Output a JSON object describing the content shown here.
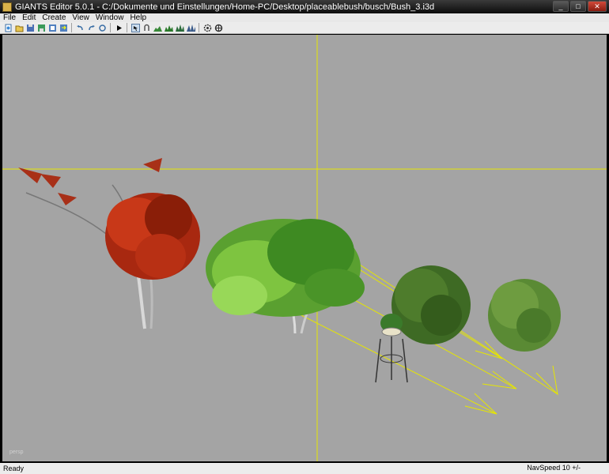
{
  "window": {
    "title": "GIANTS Editor 5.0.1 - C:/Dokumente und Einstellungen/Home-PC/Desktop/placeablebush/busch/Bush_3.i3d",
    "minimize": "_",
    "maximize": "□",
    "close": "✕"
  },
  "menu": {
    "file": "File",
    "edit": "Edit",
    "create": "Create",
    "view": "View",
    "window": "Window",
    "help": "Help"
  },
  "toolbar": {
    "icons": [
      "new-icon",
      "open-icon",
      "save-icon",
      "save-as-icon",
      "import-icon",
      "export-icon",
      "undo-icon",
      "redo-icon",
      "play-icon",
      "select-icon",
      "translate-icon",
      "terrain-icon",
      "paint-icon",
      "foliage-icon",
      "grass-icon",
      "settings-icon",
      "snap-icon"
    ]
  },
  "viewport": {
    "label": "persp",
    "background": "#a4a4a4",
    "axis_color": "#e6e600"
  },
  "status": {
    "text": "Ready",
    "navspeed": "NavSpeed 10 +/-"
  }
}
